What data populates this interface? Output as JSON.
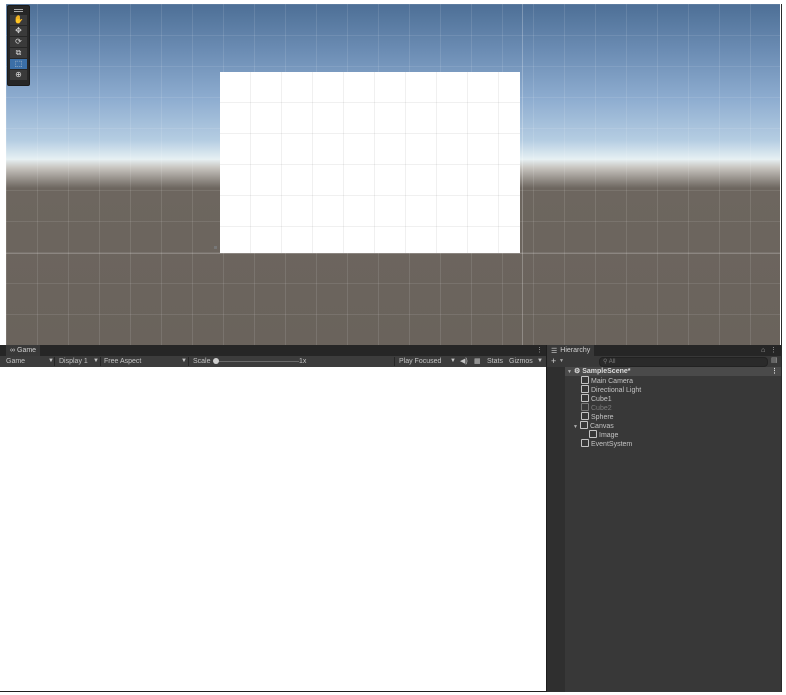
{
  "scene_tools": [
    {
      "name": "hand",
      "icon": "✋"
    },
    {
      "name": "move",
      "icon": "✥"
    },
    {
      "name": "rotate",
      "icon": "⟳"
    },
    {
      "name": "scale",
      "icon": "⧉"
    },
    {
      "name": "rect",
      "icon": "⬚"
    },
    {
      "name": "transform",
      "icon": "⊕"
    }
  ],
  "game": {
    "tab_label": "Game",
    "toolbar": {
      "mode": "Game",
      "display": "Display 1",
      "aspect": "Free Aspect",
      "scale_label": "Scale",
      "scale_value": "1x",
      "play_mode": "Play Focused",
      "stats": "Stats",
      "gizmos": "Gizmos"
    }
  },
  "hierarchy": {
    "tab_label": "Hierarchy",
    "search_placeholder": "All",
    "add_label": "+",
    "scene": "SampleScene*",
    "items": [
      {
        "label": "Main Camera"
      },
      {
        "label": "Directional Light"
      },
      {
        "label": "Cube1"
      },
      {
        "label": "Cube2"
      },
      {
        "label": "Sphere"
      },
      {
        "label": "Canvas"
      },
      {
        "label": "Image"
      },
      {
        "label": "EventSystem"
      }
    ]
  },
  "colors": {
    "panel_bg": "#383838",
    "tab_bg": "#262626",
    "active_tool": "#3b6fa7"
  }
}
